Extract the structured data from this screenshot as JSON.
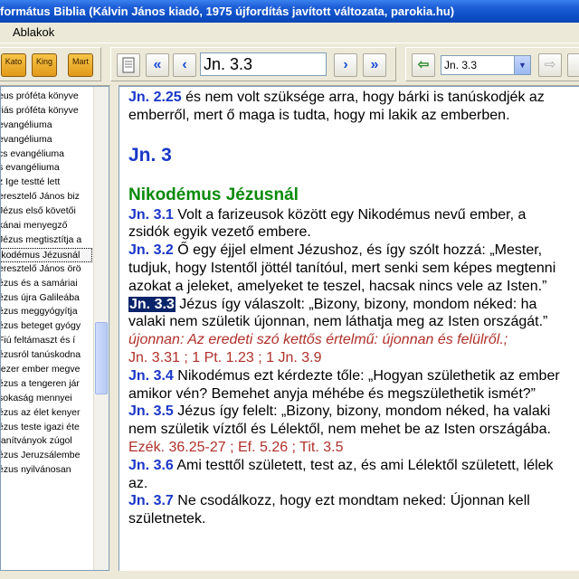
{
  "window": {
    "title": "formátus Biblia (Kálvin János kiadó, 1975 újfordítás javított változata, parokia.hu)"
  },
  "menu": {
    "ablakok": "Ablakok"
  },
  "toolbar": {
    "books": [
      "Kato",
      "King",
      "Mart"
    ],
    "reference": "Jn. 3.3",
    "history_value": "Jn. 3.3"
  },
  "sidebar": {
    "items": [
      "eus próféta könyve",
      "riás próféta könyve",
      "evangéliuma",
      "evangéliuma",
      "cs evangéliuma",
      "s evangéliuma",
      "z Ige testté lett",
      "eresztelő János biz",
      "Jézus első követői",
      "kánai menyegző",
      "Jézus megtisztítja a",
      "ikodémus Jézusnál",
      "eresztelő János örö",
      "ézus és a samáriai",
      "ézus újra Galileába",
      "ézus meggyógyítja",
      "ézus beteget gyógy",
      "Fiú feltámaszt és í",
      "ézusról tanúskodna",
      "tezer ember megve",
      "ézus a tengeren jár",
      "sokaság mennyei",
      "ézus az élet kenyer",
      "ézus teste igazi éte",
      "tanítványok zúgol",
      "ézus Jeruzsálembe",
      "ézus nyilvánosan"
    ],
    "selected_index": 11
  },
  "reader": {
    "prev": {
      "ref": "Jn. 2.25",
      "line1": " és nem volt szüksége arra, hogy bárki is tanúskodjék az",
      "line2": "emberről, mert ő maga is tudta, hogy mi lakik az emberben."
    },
    "chapter": "Jn. 3",
    "section": "Nikodémus Jézusnál",
    "v1": {
      "ref": "Jn. 3.1",
      "line1": " Volt a farizeusok között egy Nikodémus nevű ember, a",
      "line2": "zsidók egyik vezető embere."
    },
    "v2": {
      "ref": "Jn. 3.2",
      "line1": " Ő egy éjjel elment Jézushoz, és így szólt hozzá: „Mester,",
      "line2": "tudjuk, hogy Istentől jöttél tanítóul, mert senki sem képes megtenni",
      "line3": "azokat a jeleket, amelyeket te teszel, hacsak nincs vele az Isten.”"
    },
    "v3": {
      "ref": "Jn. 3.3",
      "line1": " Jézus így válaszolt: „Bizony, bizony, mondom néked: ha",
      "line2": "valaki nem születik újonnan, nem láthatja meg az Isten országát.”",
      "note": "újonnan: Az eredeti szó kettős értelmű: újonnan és felülről.;",
      "xref": "Jn. 3.31 ; 1 Pt. 1.23 ; 1 Jn. 3.9"
    },
    "v4": {
      "ref": "Jn. 3.4",
      "line1": " Nikodémus ezt kérdezte tőle: „Hogyan születhetik az ember",
      "line2": "amikor vén? Bemehet anyja méhébe és megszülethetik ismét?”"
    },
    "v5": {
      "ref": "Jn. 3.5",
      "line1": " Jézus így felelt: „Bizony, bizony, mondom néked, ha valaki",
      "line2": "nem születik víztől és Lélektől, nem mehet be az Isten országába.",
      "xref": "Ezék. 36.25-27 ; Ef. 5.26 ; Tit. 3.5"
    },
    "v6": {
      "ref": "Jn. 3.6",
      "line1": " Ami testtől született, test az, és ami Lélektől született, lélek",
      "line2": "az."
    },
    "v7": {
      "ref": "Jn. 3.7",
      "line1": " Ne csodálkozz, hogy ezt mondtam neked: Újonnan kell",
      "line2": "születnetek."
    }
  }
}
